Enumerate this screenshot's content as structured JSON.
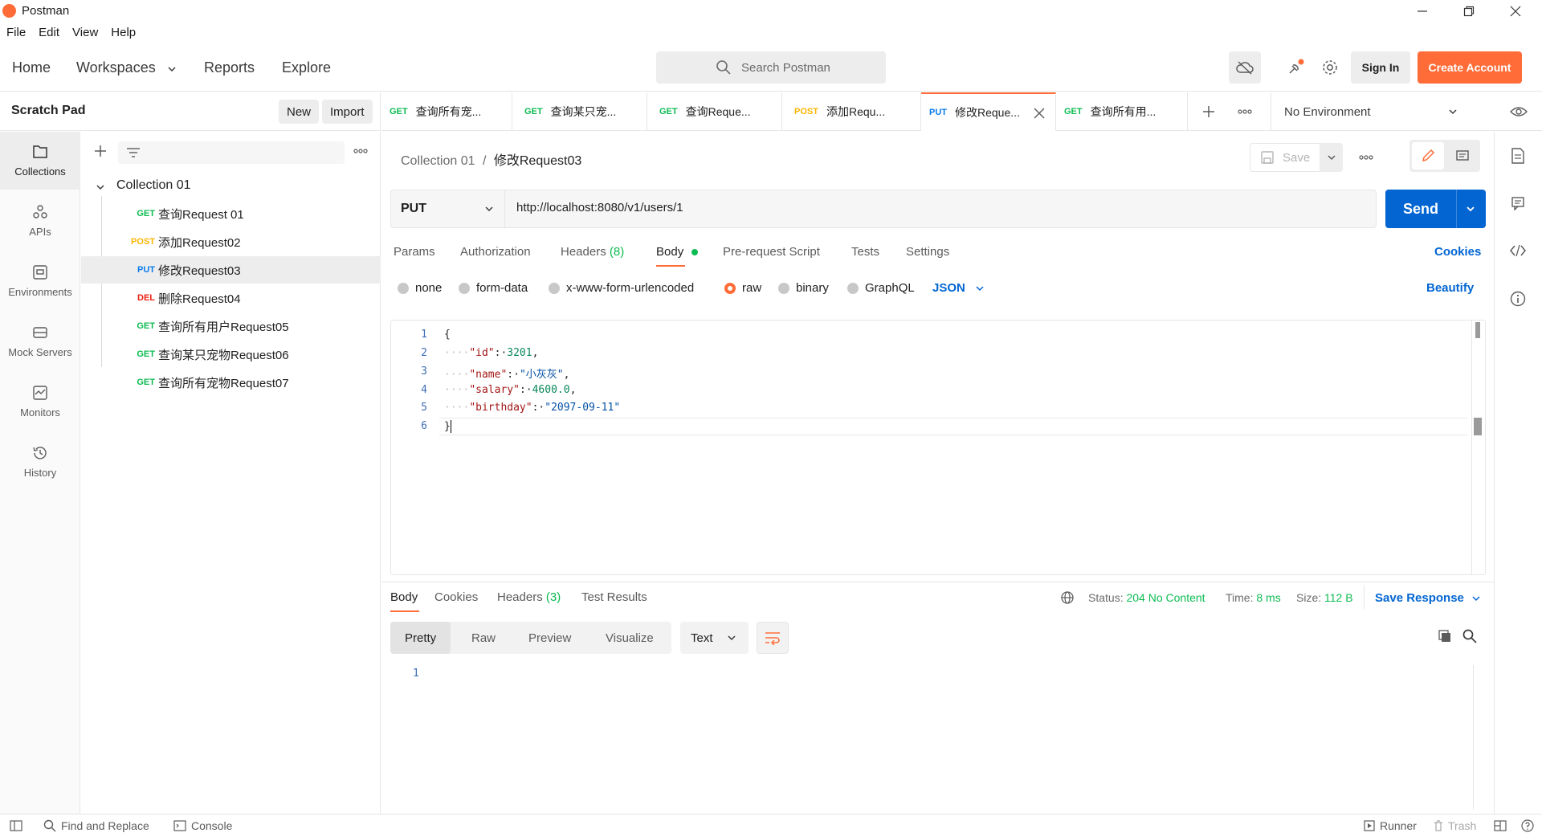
{
  "window": {
    "title": "Postman"
  },
  "menu": [
    "File",
    "Edit",
    "View",
    "Help"
  ],
  "header": {
    "nav": [
      "Home",
      "Workspaces",
      "Reports",
      "Explore"
    ],
    "search_placeholder": "Search Postman",
    "sign_in": "Sign In",
    "create_account": "Create Account"
  },
  "workspace": {
    "title": "Scratch Pad",
    "new_label": "New",
    "import_label": "Import"
  },
  "rail": [
    {
      "label": "Collections",
      "icon": "collections-icon"
    },
    {
      "label": "APIs",
      "icon": "apis-icon"
    },
    {
      "label": "Environments",
      "icon": "environments-icon"
    },
    {
      "label": "Mock Servers",
      "icon": "mock-servers-icon"
    },
    {
      "label": "Monitors",
      "icon": "monitors-icon"
    },
    {
      "label": "History",
      "icon": "history-icon"
    }
  ],
  "collection": {
    "name": "Collection 01",
    "requests": [
      {
        "method": "GET",
        "name": "查询Request 01"
      },
      {
        "method": "POST",
        "name": "添加Request02"
      },
      {
        "method": "PUT",
        "name": "修改Request03"
      },
      {
        "method": "DEL",
        "name": "删除Request04"
      },
      {
        "method": "GET",
        "name": "查询所有用户Request05"
      },
      {
        "method": "GET",
        "name": "查询某只宠物Request06"
      },
      {
        "method": "GET",
        "name": "查询所有宠物Request07"
      }
    ]
  },
  "tabs": [
    {
      "method": "GET",
      "label": "查询所有宠..."
    },
    {
      "method": "GET",
      "label": "查询某只宠..."
    },
    {
      "method": "GET",
      "label": "查询Reque..."
    },
    {
      "method": "POST",
      "label": "添加Requ..."
    },
    {
      "method": "PUT",
      "label": "修改Reque..."
    },
    {
      "method": "GET",
      "label": "查询所有用..."
    }
  ],
  "environment": "No Environment",
  "request": {
    "breadcrumb_parent": "Collection 01",
    "breadcrumb_sep": "/",
    "breadcrumb_current": "修改Request03",
    "save_label": "Save",
    "method": "PUT",
    "url": "http://localhost:8080/v1/users/1",
    "send_label": "Send",
    "tabs": {
      "params": "Params",
      "authorization": "Authorization",
      "headers": "Headers",
      "headers_count": "(8)",
      "body": "Body",
      "prerequest": "Pre-request Script",
      "tests": "Tests",
      "settings": "Settings",
      "cookies": "Cookies"
    },
    "body_types": [
      "none",
      "form-data",
      "x-www-form-urlencoded",
      "raw",
      "binary",
      "GraphQL"
    ],
    "body_format": "JSON",
    "beautify": "Beautify",
    "code_lines": [
      "1",
      "2",
      "3",
      "4",
      "5",
      "6"
    ],
    "json": {
      "open": "{",
      "id_key": "\"id\"",
      "id_val": "3201",
      "name_key": "\"name\"",
      "name_val": "\"小灰灰\"",
      "salary_key": "\"salary\"",
      "salary_val": "4600.0",
      "birthday_key": "\"birthday\"",
      "birthday_val": "\"2097-09-11\"",
      "close": "}"
    }
  },
  "response": {
    "tabs": {
      "body": "Body",
      "cookies": "Cookies",
      "headers": "Headers",
      "headers_count": "(3)",
      "test_results": "Test Results"
    },
    "status_label": "Status:",
    "status_value": "204 No Content",
    "time_label": "Time:",
    "time_value": "8 ms",
    "size_label": "Size:",
    "size_value": "112 B",
    "save_response": "Save Response",
    "views": [
      "Pretty",
      "Raw",
      "Preview",
      "Visualize"
    ],
    "format": "Text",
    "line_number": "1"
  },
  "statusbar": {
    "find_replace": "Find and Replace",
    "console": "Console",
    "runner": "Runner",
    "trash": "Trash"
  },
  "colors": {
    "accent": "#ff6c37",
    "send": "#0265d2",
    "get": "#0cbb52",
    "post": "#ffb400",
    "put": "#097bed",
    "delete": "#eb2013"
  }
}
